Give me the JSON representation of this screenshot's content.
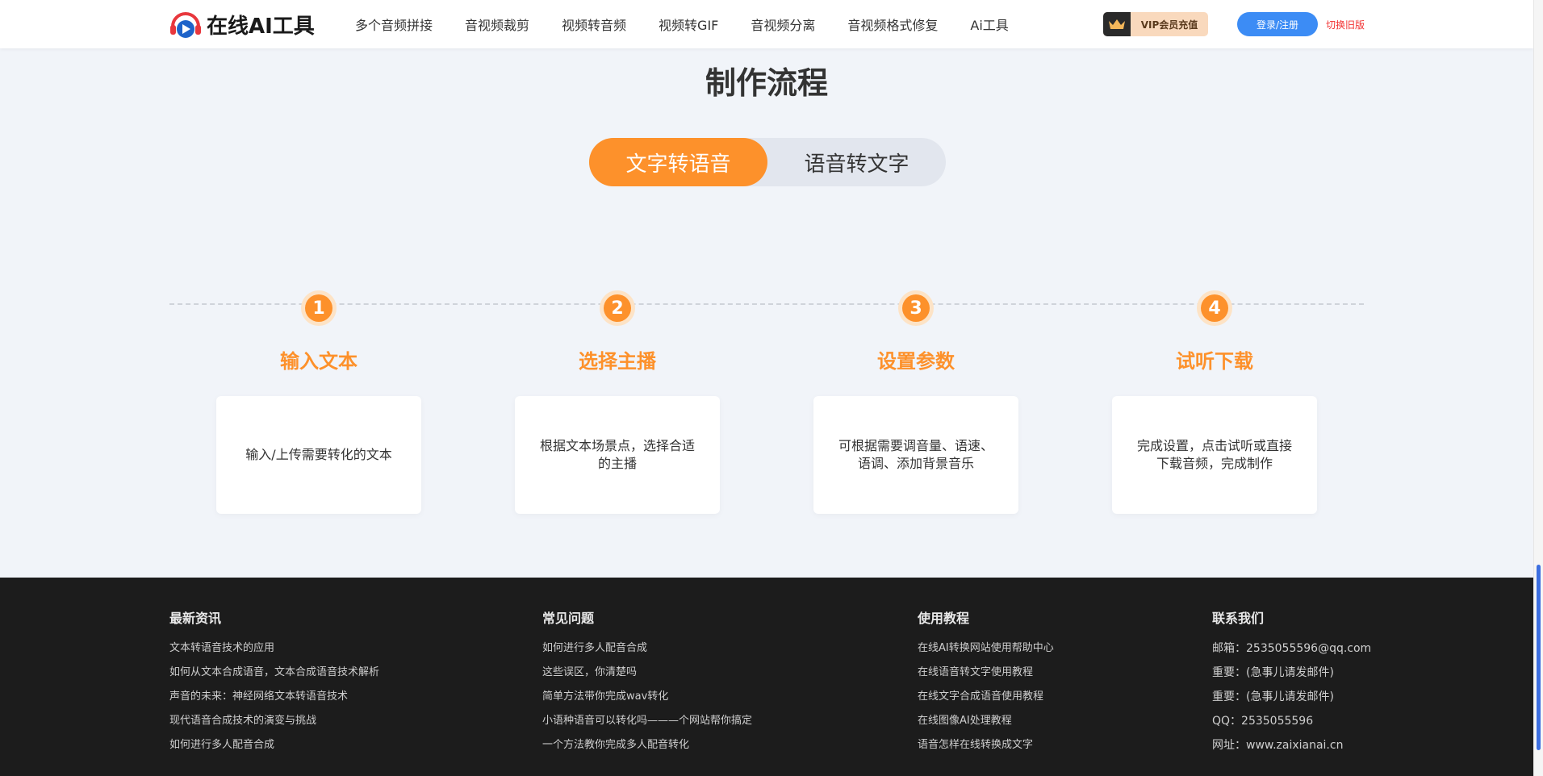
{
  "header": {
    "logo_text": "在线AI工具",
    "nav": [
      "多个音频拼接",
      "音视频裁剪",
      "视频转音频",
      "视频转GIF",
      "音视频分离",
      "音视频格式修复",
      "Ai工具"
    ],
    "vip_label": "VIP会员充值",
    "login_label": "登录/注册",
    "switch_label": "切换旧版"
  },
  "main": {
    "title": "制作流程",
    "tabs": [
      {
        "label": "文字转语音",
        "active": true
      },
      {
        "label": "语音转文字",
        "active": false
      }
    ],
    "steps": [
      {
        "num": "1",
        "title": "输入文本",
        "desc": "输入/上传需要转化的文本"
      },
      {
        "num": "2",
        "title": "选择主播",
        "desc": "根据文本场景点，选择合适的主播"
      },
      {
        "num": "3",
        "title": "设置参数",
        "desc": "可根据需要调音量、语速、语调、添加背景音乐"
      },
      {
        "num": "4",
        "title": "试听下载",
        "desc": "完成设置，点击试听或直接下载音频，完成制作"
      }
    ]
  },
  "footer": {
    "columns": [
      {
        "title": "最新资讯",
        "links": [
          "文本转语音技术的应用",
          "如何从文本合成语音，文本合成语音技术解析",
          "声音的未来：神经网络文本转语音技术",
          "现代语音合成技术的演变与挑战",
          "如何进行多人配音合成"
        ]
      },
      {
        "title": "常见问题",
        "links": [
          "如何进行多人配音合成",
          "这些误区，你清楚吗",
          "简单方法带你完成wav转化",
          "小语种语音可以转化吗———个网站帮你搞定",
          "一个方法教你完成多人配音转化"
        ]
      },
      {
        "title": "使用教程",
        "links": [
          "在线AI转换网站使用帮助中心",
          "在线语音转文字使用教程",
          "在线文字合成语音使用教程",
          "在线图像AI处理教程",
          "语音怎样在线转换成文字"
        ]
      },
      {
        "title": "联系我们",
        "links": [
          "邮箱：2535055596@qq.com",
          "重要：(急事儿请发邮件)",
          "重要：(急事儿请发邮件)",
          "QQ：2535055596",
          "网址：www.zaixianai.cn"
        ]
      }
    ]
  },
  "colors": {
    "accent": "#fd912b",
    "login_blue": "#3c8cf5",
    "footer_bg": "#1c1c1c",
    "page_bg": "#f1f4f9"
  }
}
